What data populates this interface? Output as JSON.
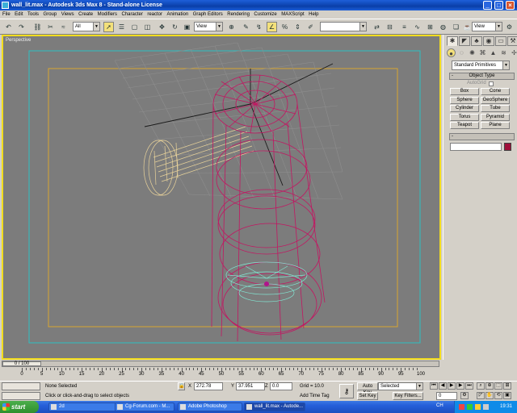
{
  "window": {
    "title": "wall_lit.max - Autodesk 3ds Max 8  - Stand-alone License",
    "minimize_icon": "minimize-icon",
    "maximize_icon": "maximize-icon",
    "close_icon": "close-icon"
  },
  "menu": [
    "File",
    "Edit",
    "Tools",
    "Group",
    "Views",
    "Create",
    "Modifiers",
    "Character",
    "reactor",
    "Animation",
    "Graph Editors",
    "Rendering",
    "Customize",
    "MAXScript",
    "Help"
  ],
  "toolbar": {
    "selection_filter": "All",
    "reference_coord": "View",
    "named_selection": "",
    "view_combo": "View"
  },
  "viewport": {
    "label": "Perspective",
    "border_color": "#f2dd1e",
    "bg_color": "#7c7c7c"
  },
  "command_panel": {
    "category": "Standard Primitives",
    "object_type_header": "Object Type",
    "autogrid_label": "AutoGrid",
    "buttons": [
      "Box",
      "Cone",
      "Sphere",
      "GeoSphere",
      "Cylinder",
      "Tube",
      "Torus",
      "Pyramid",
      "Teapot",
      "Plane"
    ],
    "name_color_header": "Name and Color",
    "name_value": "",
    "object_color": "#a0103a",
    "rollout_toggle": "-"
  },
  "timeline": {
    "slider_label": "0 / 100",
    "ticks": [
      "0",
      "5",
      "10",
      "15",
      "20",
      "25",
      "30",
      "35",
      "40",
      "45",
      "50",
      "55",
      "60",
      "65",
      "70",
      "75",
      "80",
      "85",
      "90",
      "95",
      "100"
    ]
  },
  "status": {
    "selection": "None Selected",
    "prompt": "Click or click-and-drag to select objects",
    "x_label": "X",
    "x_value": "272.78",
    "y_label": "Y",
    "y_value": "37.951",
    "z_label": "Z",
    "z_value": "0.0",
    "grid": "Grid = 10.0",
    "add_time_tag": "Add Time Tag",
    "auto_key": "Auto Key",
    "set_key": "Set Key",
    "key_mode": "Selected",
    "key_filters": "Key Filters...",
    "frame": "0"
  },
  "taskbar": {
    "start": "start",
    "tasks": [
      "2d",
      "Cg-Forum.com - M...",
      "Adobe Photoshop",
      "wall_lit.max - Autode..."
    ],
    "lang": "CH",
    "clock": "19:31"
  }
}
